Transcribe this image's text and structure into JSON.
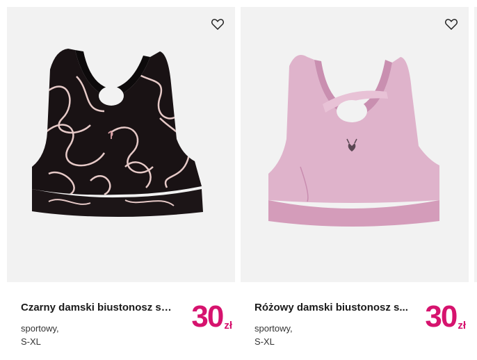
{
  "products": [
    {
      "title": "Czarny damski biustonosz sp...",
      "subtitle": "sportowy,",
      "sizes": "S-XL",
      "price": "30",
      "currency": "zł",
      "image_icon": "black-sports-bra-image",
      "color": "#1a1416"
    },
    {
      "title": "Różowy damski biustonosz s...",
      "subtitle": "sportowy,",
      "sizes": "S-XL",
      "price": "30",
      "currency": "zł",
      "image_icon": "pink-sports-bra-image",
      "color": "#d9a9c2"
    }
  ],
  "colors": {
    "price": "#d6136e",
    "image_background": "#f2f2f2"
  },
  "favorite_icon": "heart-outline-icon"
}
